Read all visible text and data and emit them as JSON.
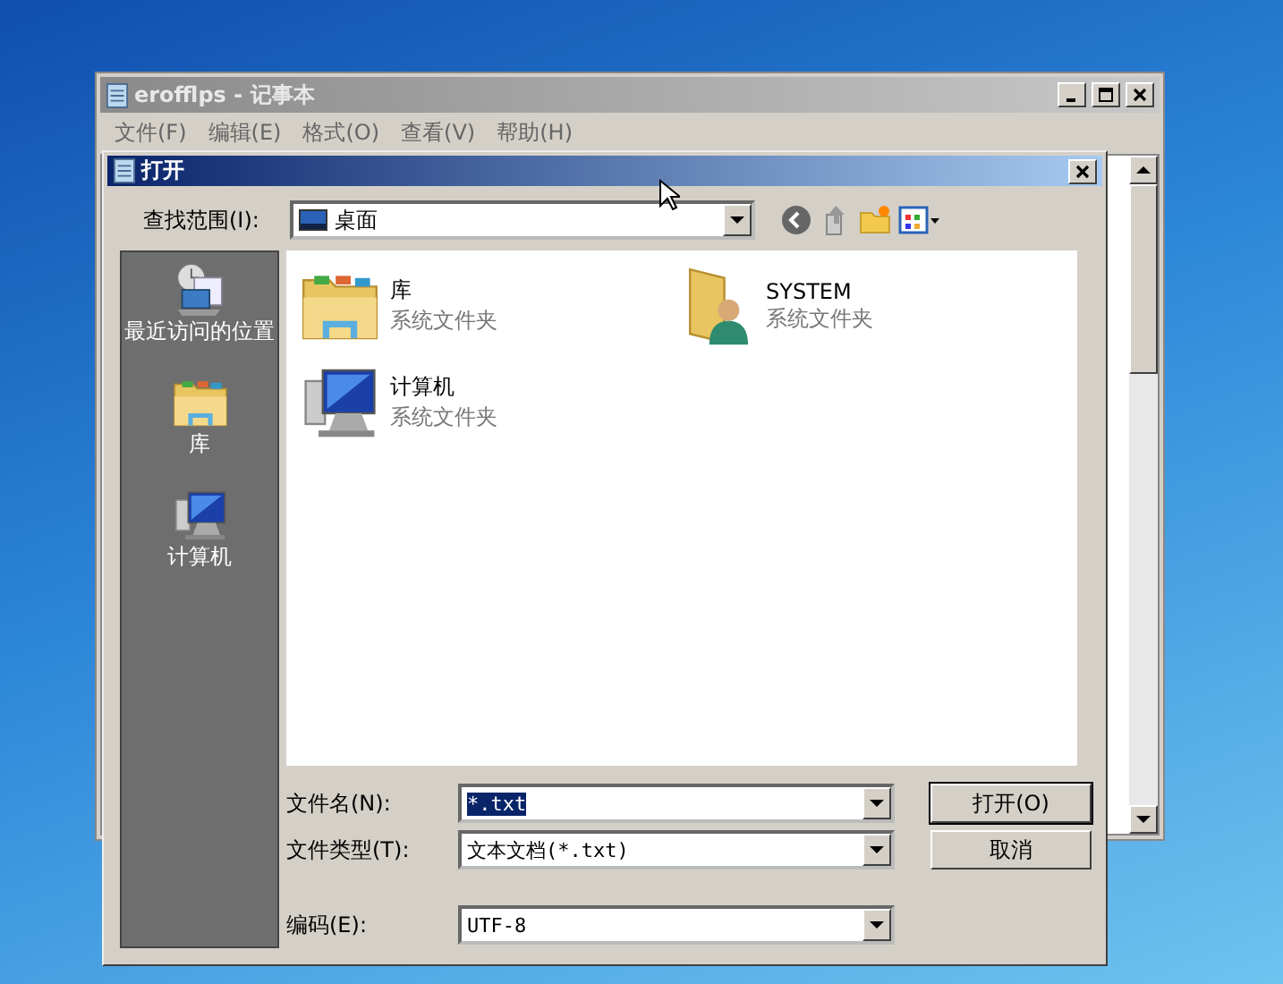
{
  "notepad": {
    "title": "erofflps - 记事本",
    "menu": [
      "文件(F)",
      "编辑(E)",
      "格式(O)",
      "查看(V)",
      "帮助(H)"
    ]
  },
  "dialog": {
    "title": "打开",
    "look_in": {
      "label": "查找范围(I):",
      "value": "桌面"
    },
    "places": [
      {
        "label": "最近访问的位置",
        "kind": "recent"
      },
      {
        "label": "库",
        "kind": "library"
      },
      {
        "label": "计算机",
        "kind": "computer"
      }
    ],
    "files": [
      {
        "name": "库",
        "type": "系统文件夹",
        "kind": "library"
      },
      {
        "name": "SYSTEM",
        "type": "系统文件夹",
        "kind": "user"
      },
      {
        "name": "计算机",
        "type": "系统文件夹",
        "kind": "computer"
      }
    ],
    "filename": {
      "label": "文件名(N):",
      "value": "*.txt",
      "selected": true
    },
    "filetype": {
      "label": "文件类型(T):",
      "value": "文本文档(*.txt)"
    },
    "encoding": {
      "label": "编码(E):",
      "value": "UTF-8"
    },
    "buttons": [
      "打开(O)",
      "取消"
    ]
  }
}
